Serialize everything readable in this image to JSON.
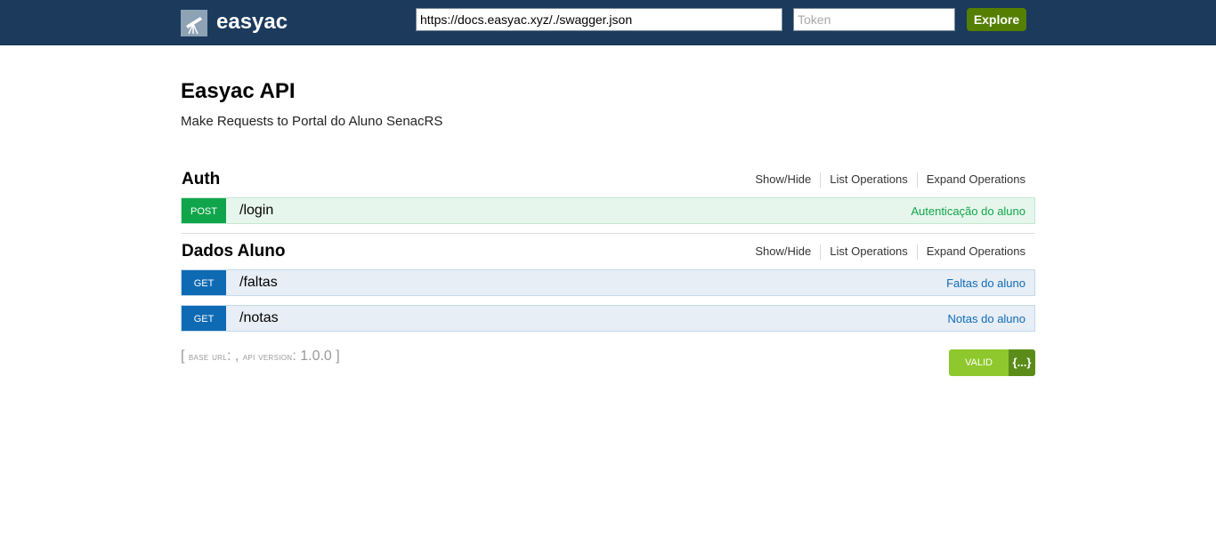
{
  "header": {
    "brand": "easyac",
    "url_value": "https://docs.easyac.xyz/./swagger.json",
    "token_placeholder": "Token",
    "explore_label": "Explore"
  },
  "info": {
    "title": "Easyac API",
    "description": "Make Requests to Portal do Aluno SenacRS"
  },
  "resources": [
    {
      "name": "Auth",
      "ops_labels": [
        "Show/Hide",
        "List Operations",
        "Expand Operations"
      ],
      "operations": [
        {
          "method": "POST",
          "path": "/login",
          "summary": "Autenticação do aluno"
        }
      ]
    },
    {
      "name": "Dados Aluno",
      "ops_labels": [
        "Show/Hide",
        "List Operations",
        "Expand Operations"
      ],
      "operations": [
        {
          "method": "GET",
          "path": "/faltas",
          "summary": "Faltas do aluno"
        },
        {
          "method": "GET",
          "path": "/notas",
          "summary": "Notas do aluno"
        }
      ]
    }
  ],
  "footer": {
    "open_bracket": "[",
    "base_url_label": "base url",
    "base_url_value": ": ,",
    "api_version_label": "api version",
    "api_version_value": ": 1.0.0",
    "close_bracket": "]",
    "valid_label": "VALID",
    "valid_icon": "{...}"
  },
  "colors": {
    "header_bg": "#1b3a5c",
    "explore_bg": "#547f00",
    "post": "#10a54a",
    "get": "#0f6ab4",
    "valid": "#8ec82c"
  }
}
